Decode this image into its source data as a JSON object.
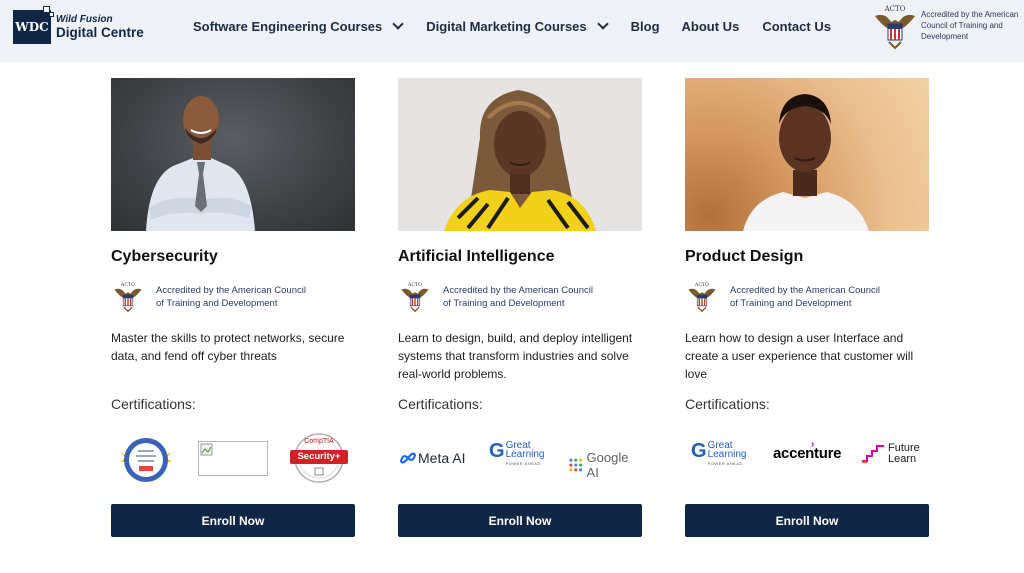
{
  "header": {
    "logo_badge": "WDC",
    "logo_line1": "Wild Fusion",
    "logo_line2": "Digital Centre",
    "nav": [
      {
        "label": "Software Engineering Courses",
        "has_dropdown": true
      },
      {
        "label": "Digital Marketing Courses",
        "has_dropdown": true
      },
      {
        "label": "Blog",
        "has_dropdown": false
      },
      {
        "label": "About Us",
        "has_dropdown": false
      },
      {
        "label": "Contact Us",
        "has_dropdown": false
      }
    ],
    "accreditation_text": "Accredited by the American Council of Training and Development",
    "seal_label": "ACTO"
  },
  "cards": [
    {
      "title": "Cybersecurity",
      "accreditation": [
        "Accredited by the American Council",
        "of Training and Development"
      ],
      "description": "Master the skills to protect networks, secure data, and fend off cyber threats",
      "cert_label": "Certifications:",
      "cert_logos": [
        "google-cybersecurity-badge",
        "broken-image",
        "comptia-security-plus"
      ],
      "comptia_top": "CompTIA",
      "comptia_main": "Security+",
      "enroll": "Enroll Now"
    },
    {
      "title": "Artificial Intelligence",
      "accreditation": [
        "Accredited by the American Council",
        "of Training and Development"
      ],
      "description": "Learn to design, build, and deploy intelligent systems that transform industries and solve real-world problems.",
      "cert_label": "Certifications:",
      "cert_logos": [
        "meta-ai",
        "great-learning",
        "google-ai"
      ],
      "meta_ai": "Meta AI",
      "great_learning_1": "Great",
      "great_learning_2": "Learning",
      "great_learning_3": "POWER AHEAD",
      "google_ai": "Google AI",
      "enroll": "Enroll Now"
    },
    {
      "title": "Product Design",
      "accreditation": [
        "Accredited by the American Council",
        "of Training and Development"
      ],
      "description": "Learn how to design a user Interface and create a user experience that customer will love",
      "cert_label": "Certifications:",
      "cert_logos": [
        "great-learning",
        "accenture",
        "future-learn"
      ],
      "great_learning_1": "Great",
      "great_learning_2": "Learning",
      "great_learning_3": "POWER AHEAD",
      "accenture": "accenture",
      "future_1": "Future",
      "future_2": "Learn",
      "enroll": "Enroll Now"
    }
  ],
  "colors": {
    "brand_navy": "#0f2744",
    "header_bg": "#eef1f5",
    "comptia_red": "#d32027",
    "accent_purple": "#a100ff"
  }
}
